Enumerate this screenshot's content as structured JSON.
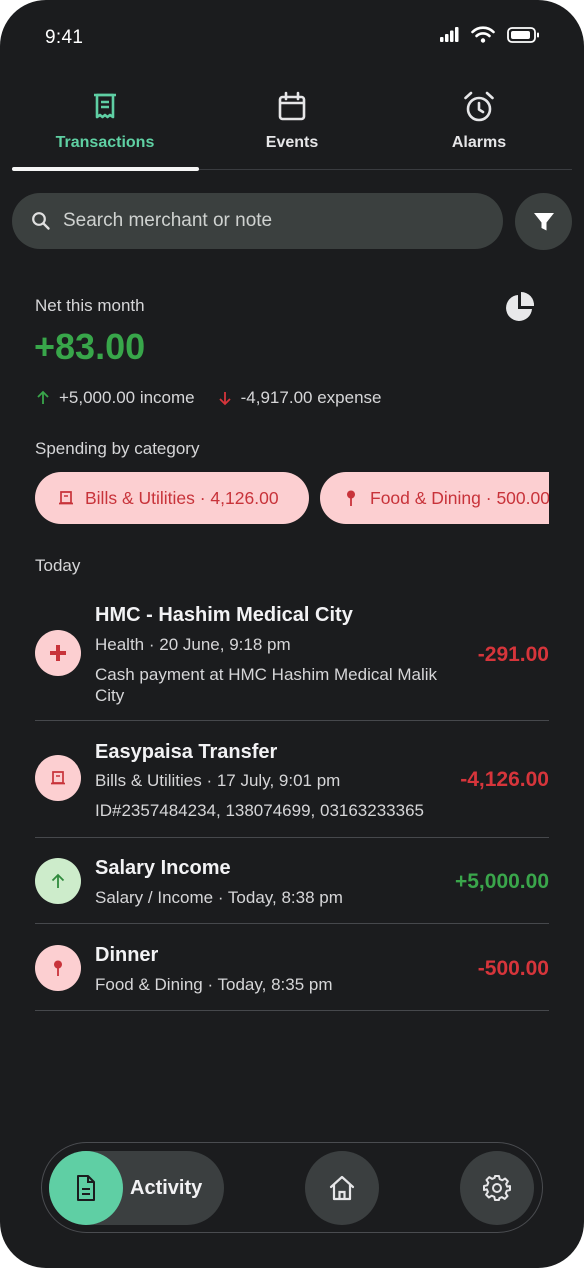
{
  "status_bar": {
    "time": "9:41"
  },
  "tabs": [
    {
      "label": "Transactions",
      "icon": "receipt-icon",
      "active": true
    },
    {
      "label": "Events",
      "icon": "calendar-icon",
      "active": false
    },
    {
      "label": "Alarms",
      "icon": "alarm-clock-icon",
      "active": false
    }
  ],
  "search": {
    "placeholder": "Search merchant or note",
    "value": ""
  },
  "summary": {
    "net_label": "Net this month",
    "net_value": "+83.00",
    "income": "+5,000.00 income",
    "expense": "-4,917.00 expense",
    "spending_label": "Spending by category"
  },
  "categories": [
    {
      "label": "Bills & Utilities · 4,126.00",
      "icon": "receipt-icon"
    },
    {
      "label": "Food & Dining · 500.00",
      "icon": "pin-icon"
    }
  ],
  "section_today": "Today",
  "transactions": [
    {
      "title": "HMC - Hashim Medical City",
      "meta": "Health · 20 June, 9:18 pm",
      "note": "Cash payment at HMC Hashim Medical Malik City",
      "amount": "-291.00",
      "icon": "plus-cross-icon"
    },
    {
      "title": "Easypaisa Transfer",
      "meta": "Bills & Utilities · 17 July, 9:01 pm",
      "note": "ID#2357484234, 138074699, 03163233365",
      "amount": "-4,126.00",
      "icon": "receipt-icon"
    },
    {
      "title": "Salary Income",
      "meta": "Salary / Income · Today, 8:38 pm",
      "amount": "+5,000.00",
      "icon": "arrow-up-icon"
    },
    {
      "title": "Dinner",
      "meta": "Food & Dining · Today, 8:35 pm",
      "amount": "-500.00",
      "icon": "pin-icon"
    }
  ],
  "bottom_nav": {
    "activity_label": "Activity"
  },
  "colors": {
    "accent": "#5fcfa4",
    "positive": "#3aa64b",
    "negative": "#d6353b",
    "chip_bg": "#fccfd1",
    "background": "#1b1c1e"
  }
}
